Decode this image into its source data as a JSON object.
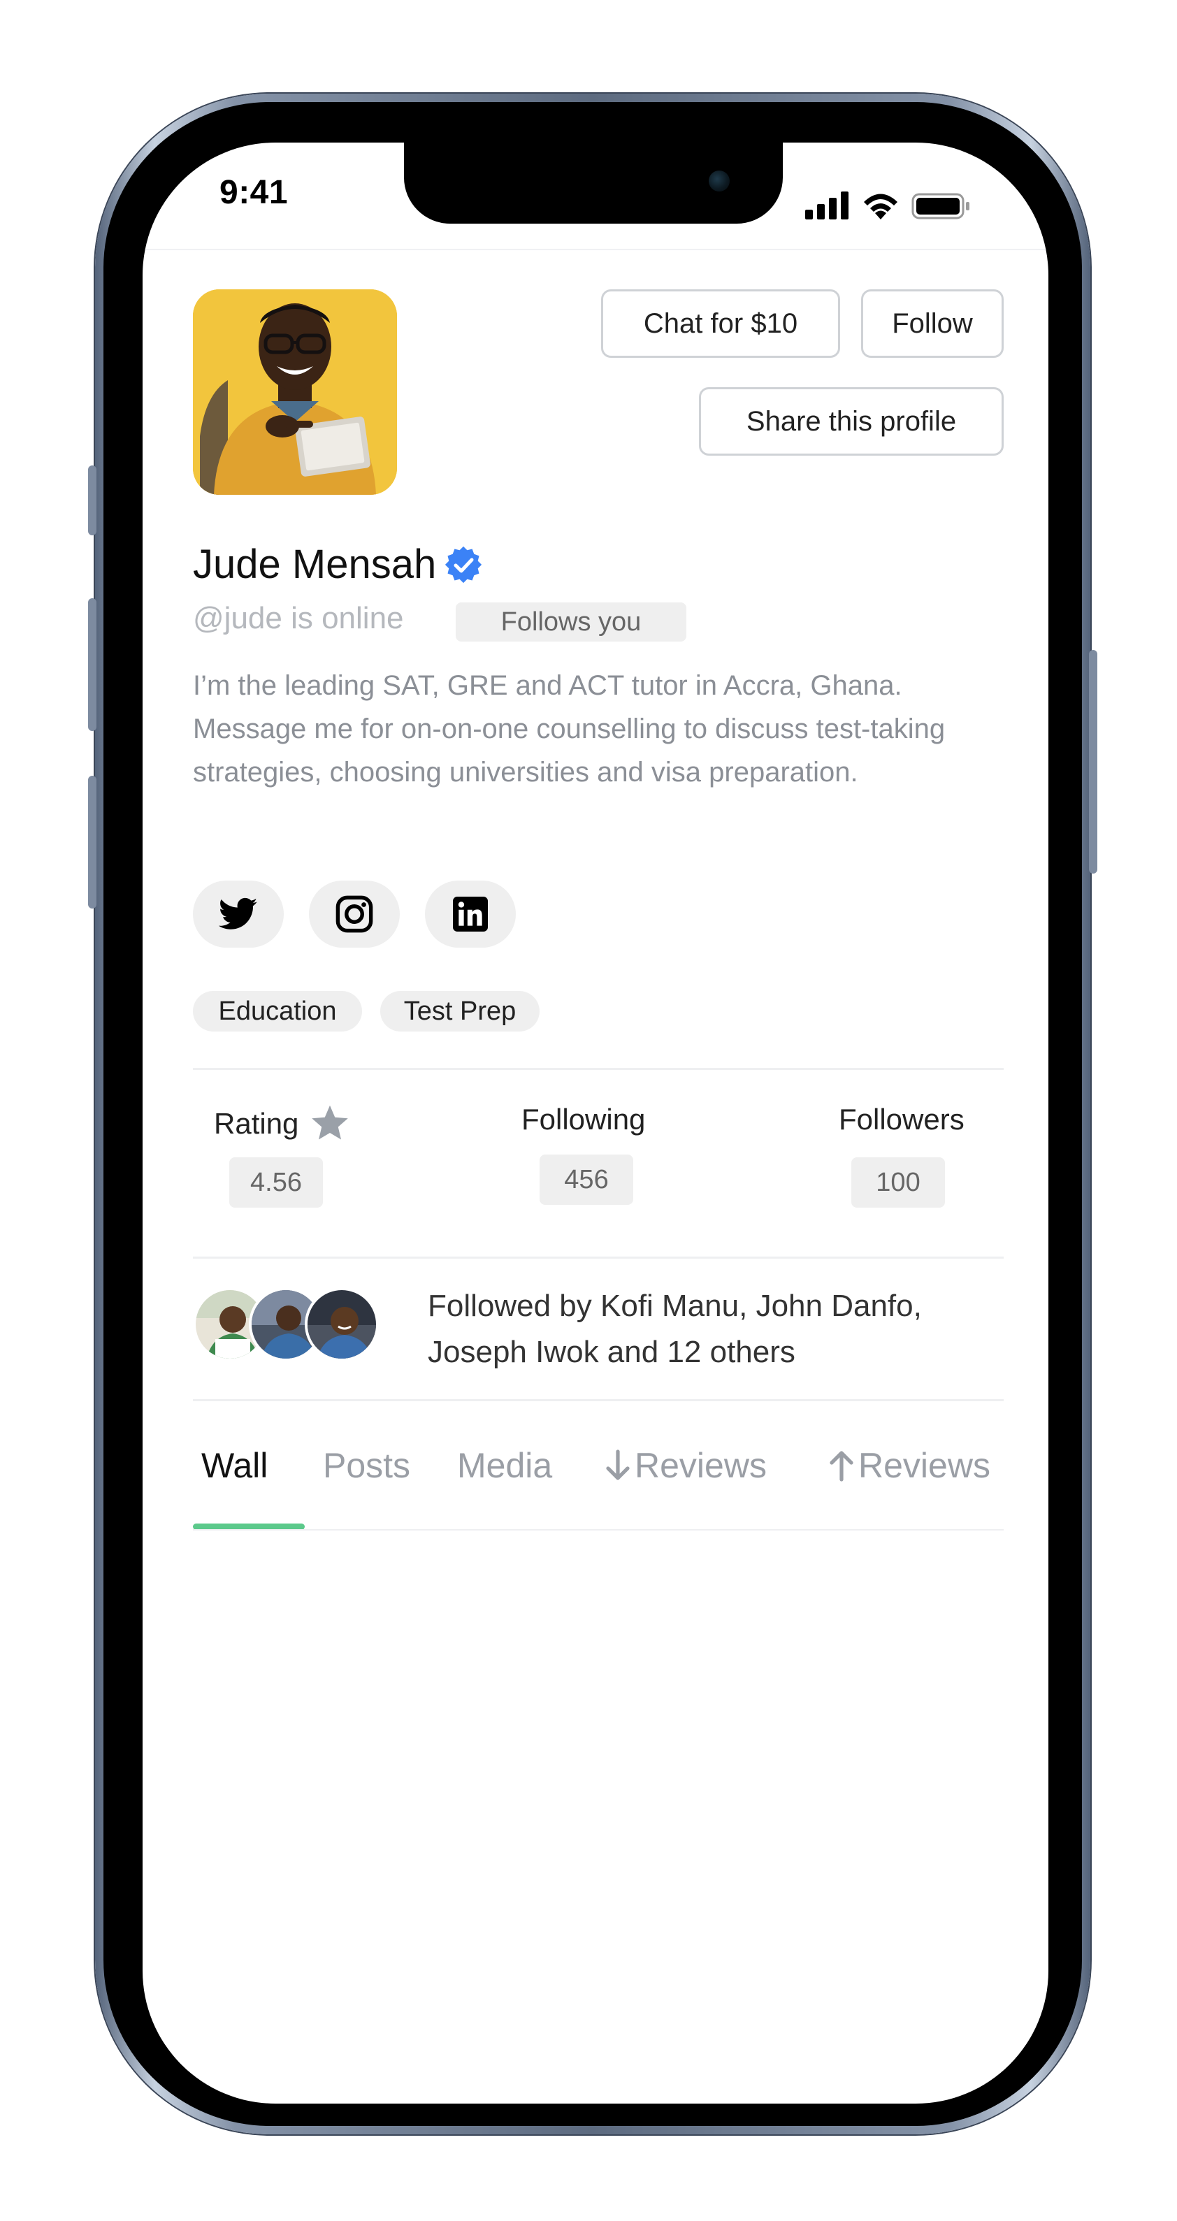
{
  "status_bar": {
    "time": "9:41"
  },
  "profile": {
    "name": "Jude Mensah",
    "handle_status": "@jude is online",
    "follows_you": "Follows you",
    "bio": "I’m the leading SAT, GRE and ACT tutor in Accra, Ghana. Message me for on-on-one counselling to discuss test-taking strategies, choosing universities and visa preparation."
  },
  "actions": {
    "chat": "Chat for $10",
    "follow": "Follow",
    "share": "Share this profile"
  },
  "social_icons": [
    "twitter-icon",
    "instagram-icon",
    "linkedin-icon"
  ],
  "tags": [
    "Education",
    "Test Prep"
  ],
  "stats": {
    "rating_label": "Rating",
    "rating_value": "4.56",
    "following_label": "Following",
    "following_value": "456",
    "followers_label": "Followers",
    "followers_value": "100"
  },
  "followed_by": "Followed by Kofi Manu, John Danfo, Joseph Iwok and 12 others",
  "tabs": [
    "Wall",
    "Posts",
    "Media",
    "Reviews",
    "Reviews"
  ],
  "colors": {
    "accent_underline": "#5cc98b",
    "verified": "#3b82f6",
    "avatar_bg": "#f2c53d"
  }
}
